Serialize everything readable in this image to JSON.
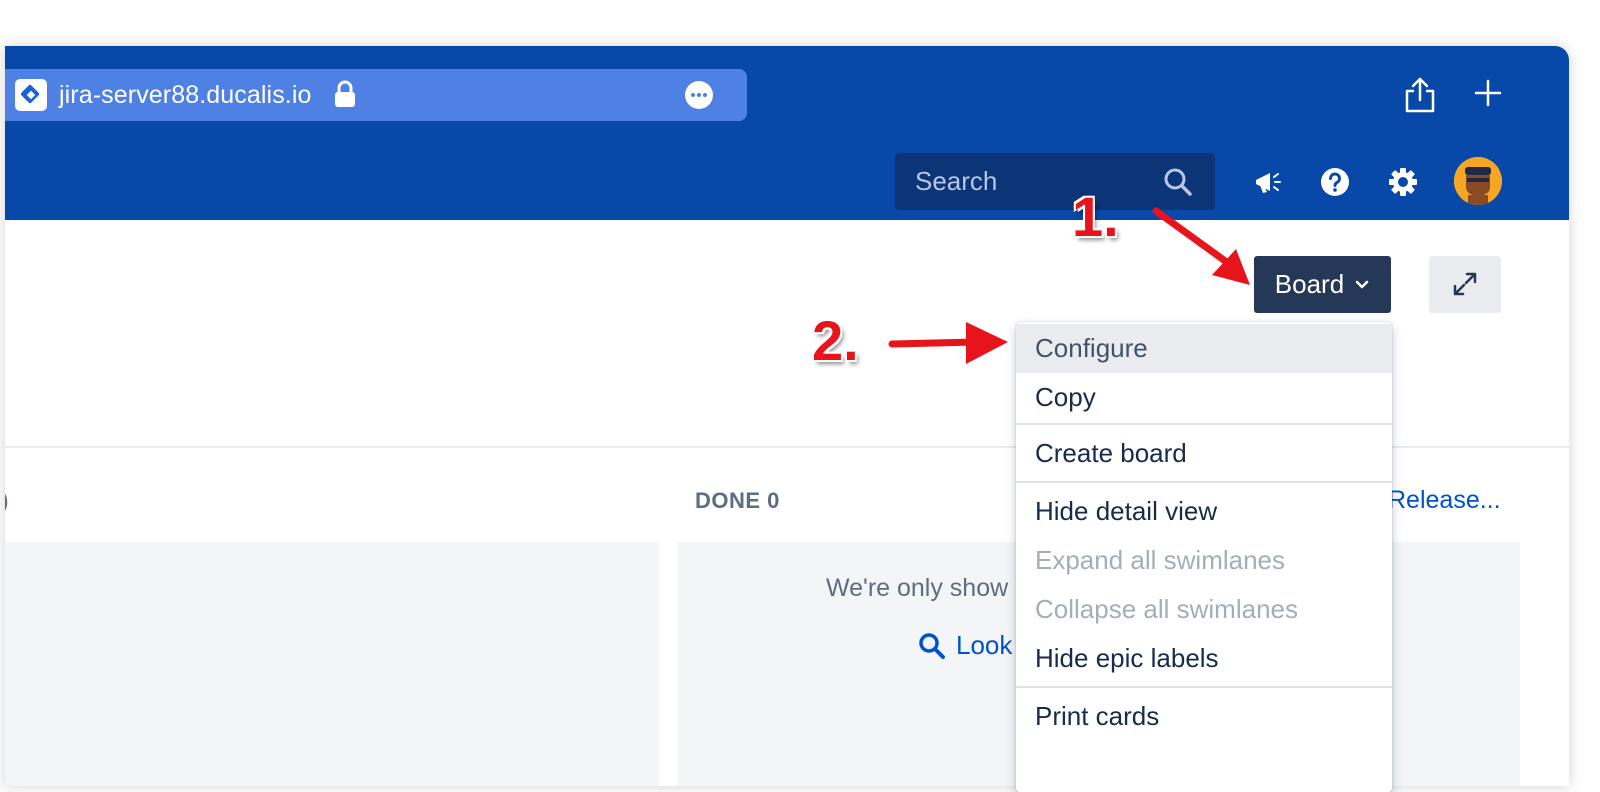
{
  "browser": {
    "url": "jira-server88.ducalis.io",
    "icons": [
      "lock-icon",
      "more-icon",
      "share-icon",
      "plus-icon"
    ]
  },
  "header": {
    "search_placeholder": "Search",
    "icons": [
      "search-icon",
      "megaphone-icon",
      "help-icon",
      "settings-icon",
      "avatar"
    ]
  },
  "board": {
    "button_label": "Board",
    "columns": [
      {
        "label": ")"
      },
      {
        "label": "DONE 0"
      }
    ],
    "release_link": "Release...",
    "empty_message": "We're only show",
    "look_link": "Look"
  },
  "dropdown": {
    "items": [
      {
        "label": "Configure",
        "state": "hover"
      },
      {
        "label": "Copy",
        "state": "normal"
      },
      {
        "label": "Create board",
        "state": "normal"
      },
      {
        "label": "Hide detail view",
        "state": "normal"
      },
      {
        "label": "Expand all swimlanes",
        "state": "disabled"
      },
      {
        "label": "Collapse all swimlanes",
        "state": "disabled"
      },
      {
        "label": "Hide epic labels",
        "state": "normal"
      },
      {
        "label": "Print cards",
        "state": "normal"
      }
    ]
  },
  "annotations": {
    "step1": "1.",
    "step2": "2."
  },
  "colors": {
    "toolbar": "#0848a8",
    "address_bar": "#4f80e3",
    "board_button": "#253858",
    "annotation": "#e8141c"
  }
}
